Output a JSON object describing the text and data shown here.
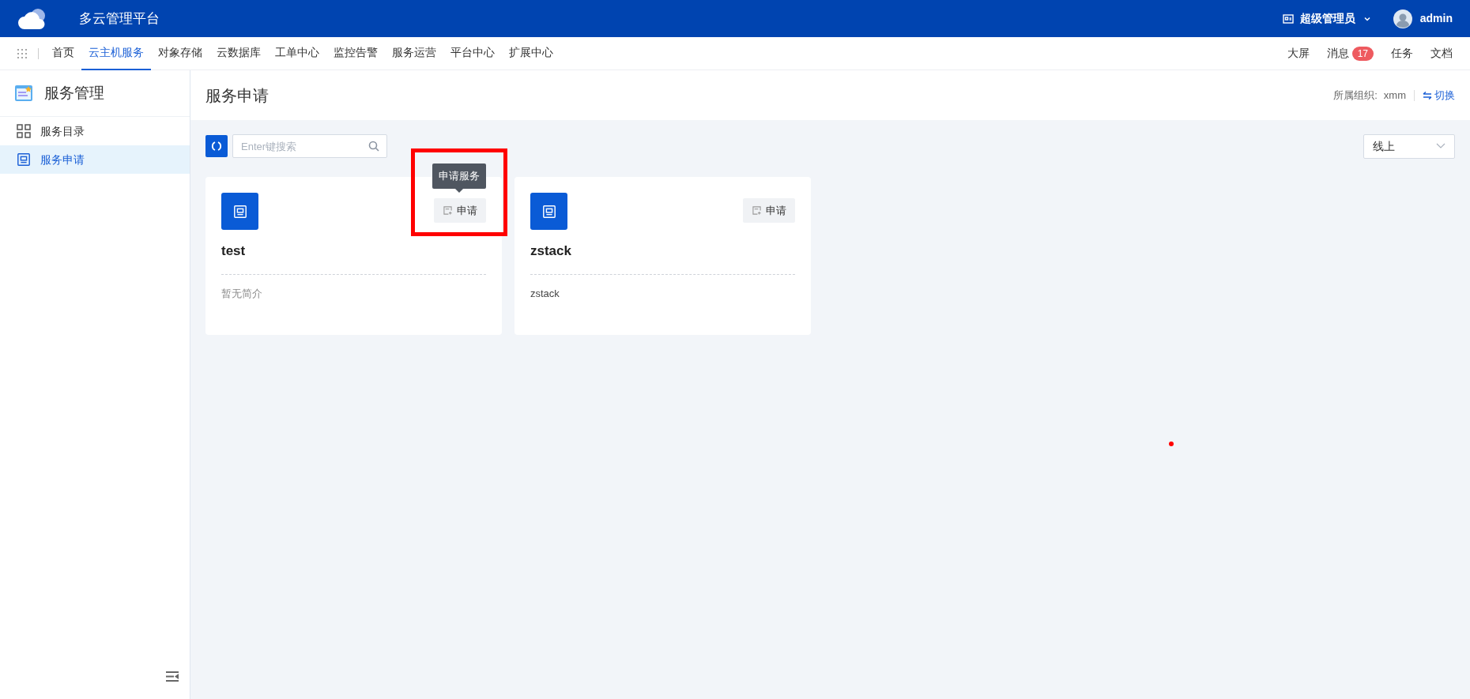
{
  "app": {
    "title": "多云管理平台"
  },
  "user": {
    "role": "超级管理员",
    "name": "admin"
  },
  "nav": [
    {
      "label": "首页",
      "selected": false
    },
    {
      "label": "云主机服务",
      "selected": true
    },
    {
      "label": "对象存储",
      "selected": false
    },
    {
      "label": "云数据库",
      "selected": false
    },
    {
      "label": "工单中心",
      "selected": false
    },
    {
      "label": "监控告警",
      "selected": false
    },
    {
      "label": "服务运营",
      "selected": false
    },
    {
      "label": "平台中心",
      "selected": false
    },
    {
      "label": "扩展中心",
      "selected": false
    }
  ],
  "nav_right": [
    {
      "label": "大屏"
    },
    {
      "label": "消息",
      "badge": "17"
    },
    {
      "label": "任务"
    },
    {
      "label": "文档"
    }
  ],
  "sidebar": {
    "title": "服务管理",
    "items": [
      {
        "label": "服务目录",
        "kind": "grid",
        "selected": false
      },
      {
        "label": "服务申请",
        "kind": "panel",
        "selected": true
      }
    ]
  },
  "page": {
    "title": "服务申请",
    "org_label": "所属组织:",
    "org_value": "xmm",
    "switch": "切换"
  },
  "search": {
    "placeholder": "Enter键搜索"
  },
  "filter": {
    "value": "线上"
  },
  "cards": [
    {
      "name": "test",
      "description": "暂无简介",
      "muted": true,
      "button": "申请",
      "tooltip": "申请服务",
      "highlighted": true
    },
    {
      "name": "zstack",
      "description": "zstack",
      "muted": false,
      "button": "申请",
      "highlighted": false
    }
  ]
}
